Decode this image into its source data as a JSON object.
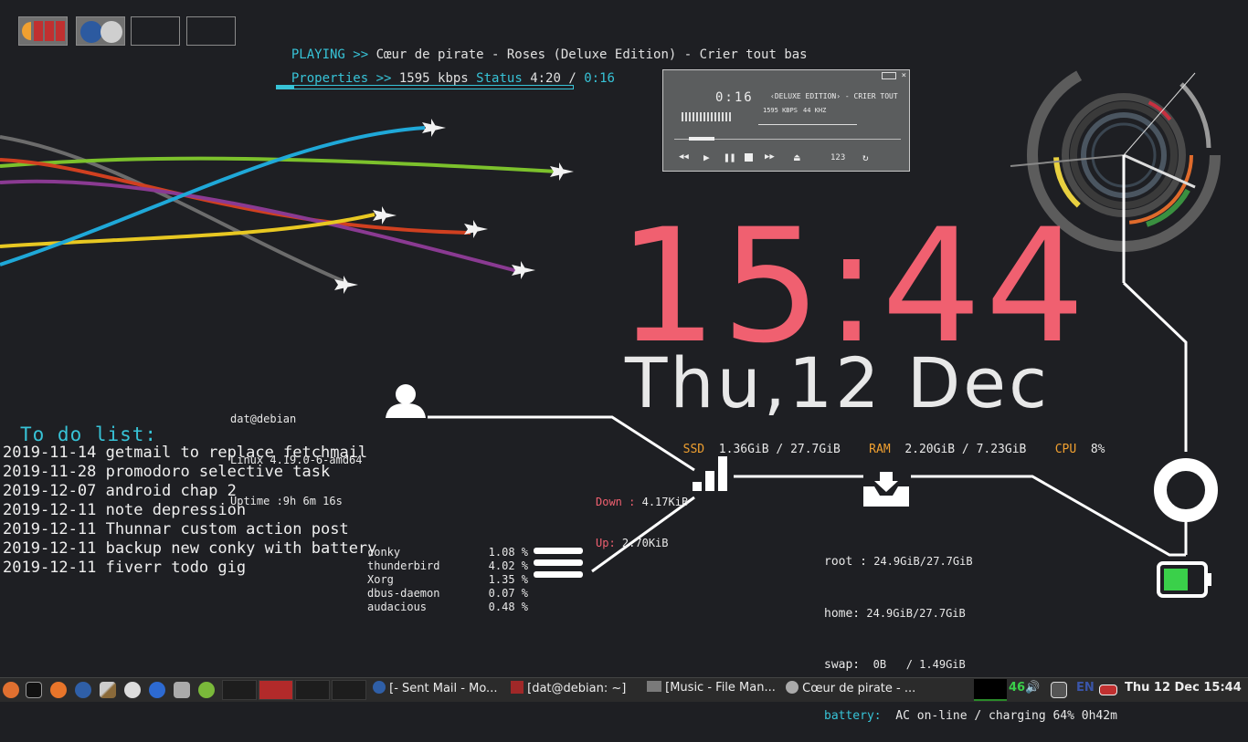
{
  "player": {
    "playing_label": "PLAYING >>",
    "track": "Cœur de pirate - Roses (Deluxe Edition) - Crier tout bas",
    "props_label": "Properties >>",
    "bitrate": "1595 kbps",
    "status_label": "Status",
    "duration": "4:20",
    "sep": "/",
    "elapsed": "0:16",
    "progress": 0.06
  },
  "mini_player": {
    "time": "0:16",
    "title": "‹DELUXE EDITION› - CRIER TOUT",
    "kbps": "1595 KBPS",
    "khz": "44 KHZ",
    "playlist_pos": "123"
  },
  "clock": {
    "time": "15:44",
    "date": "Thu,12 Dec"
  },
  "sysinfo": {
    "ssd_label": "SSD",
    "ssd": "1.36GiB / 27.7GiB",
    "ram_label": "RAM",
    "ram": "2.20GiB / 7.23GiB",
    "cpu_label": "CPU",
    "cpu": "8%"
  },
  "user": {
    "host": "dat@debian",
    "kernel": "Linux 4.19.0-6-amd64",
    "uptime": "Uptime :9h 6m 16s"
  },
  "network": {
    "down_label": "Down :",
    "down": "4.17KiB",
    "up_label": "Up:",
    "up": "2.70KiB"
  },
  "disks": {
    "root_label": "root :",
    "root": "24.9GiB/27.7GiB",
    "home_label": "home:",
    "home": "24.9GiB/27.7GiB",
    "swap_label": "swap:",
    "swap": "0B   / 1.49GiB",
    "battery_label": "battery:",
    "battery": "AC on-line / charging 64% 0h42m"
  },
  "processes": [
    {
      "name": "conky",
      "cpu": "1.08 %"
    },
    {
      "name": "thunderbird",
      "cpu": "4.02 %"
    },
    {
      "name": "Xorg",
      "cpu": "1.35 %"
    },
    {
      "name": "dbus-daemon",
      "cpu": "0.07 %"
    },
    {
      "name": "audacious",
      "cpu": "0.48 %"
    }
  ],
  "todo": {
    "title": "To do list:",
    "items": [
      "2019-11-14 getmail to replace fetchmail",
      "2019-11-28 promodoro selective task",
      "2019-12-07 android chap 2",
      "2019-12-11 note depression",
      "2019-12-11 Thunnar custom action post",
      "2019-12-11 backup new conky with battery",
      "2019-12-11 fiverr todo gig"
    ]
  },
  "taskbar": {
    "tasks": [
      "[- Sent Mail - Mo...",
      "[dat@debian: ~]",
      "[Music - File Man...",
      "Cœur de pirate - ..."
    ],
    "volume_level": "46",
    "keyboard_layout": "EN",
    "datetime": "Thu 12 Dec 15:44"
  },
  "colors": {
    "accent": "#37c3d7",
    "clock": "#f06070",
    "label": "#f0a030",
    "battery": "#3ad04a"
  }
}
